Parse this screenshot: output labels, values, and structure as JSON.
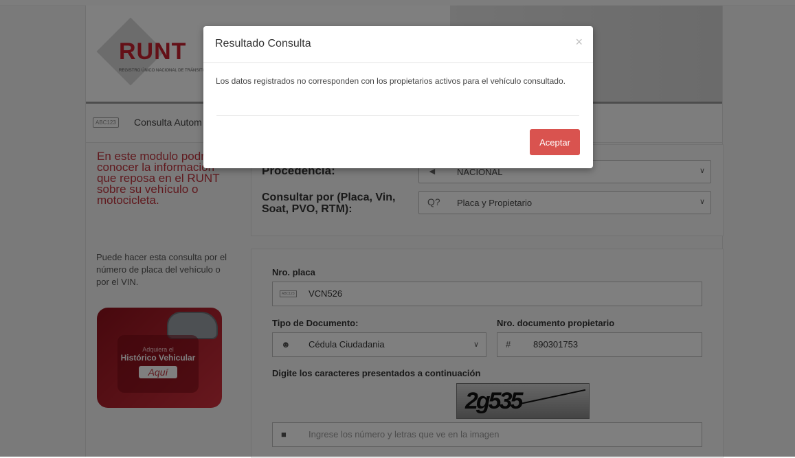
{
  "header": {
    "logo_text": "RUNT",
    "logo_subtitle": "REGISTRO ÚNICO NACIONAL DE TRÁNSITO"
  },
  "tabbar": {
    "tag": "ABC123",
    "label": "Consulta Autom"
  },
  "sidebar": {
    "intro": "En este modulo podrá conocer la información que reposa en el RUNT sobre su vehículo o motocicleta.",
    "note": "Puede hacer esta consulta por el número de placa del vehículo o por el VIN.",
    "promo": {
      "small": "Adquiera el",
      "big": "Histórico Vehicular",
      "button": "Aquí"
    }
  },
  "form": {
    "procedencia_label": "Procedencia:",
    "procedencia_value": "NACIONAL",
    "consultar_label": "Consultar por (Placa, Vin, Soat, PVO, RTM):",
    "consultar_value": "Placa y Propietario",
    "placa_label": "Nro. placa",
    "placa_tag": "ABC123",
    "placa_value": "VCN526",
    "tipo_doc_label": "Tipo de Documento:",
    "tipo_doc_value": "Cédula Ciudadania",
    "nro_doc_label": "Nro. documento propietario",
    "nro_doc_value": "890301753",
    "captcha_label": "Digite los caracteres presentados a continuación",
    "captcha_text": "2g535",
    "captcha_placeholder": "Ingrese los número y letras que ve en la imagen"
  },
  "modal": {
    "title": "Resultado Consulta",
    "close": "×",
    "message": "Los datos registrados no corresponden con los propietarios activos para el vehículo consultado.",
    "accept": "Aceptar"
  },
  "icons": {
    "dropdown": "chevron-down-icon",
    "search": "search-question-icon",
    "user": "user-icon",
    "hash": "hash-icon",
    "lock": "lock-icon"
  },
  "colors": {
    "brand_red": "#c8202f",
    "accept_button": "#d9534f",
    "overlay": "rgba(0,0,0,0.5)"
  }
}
